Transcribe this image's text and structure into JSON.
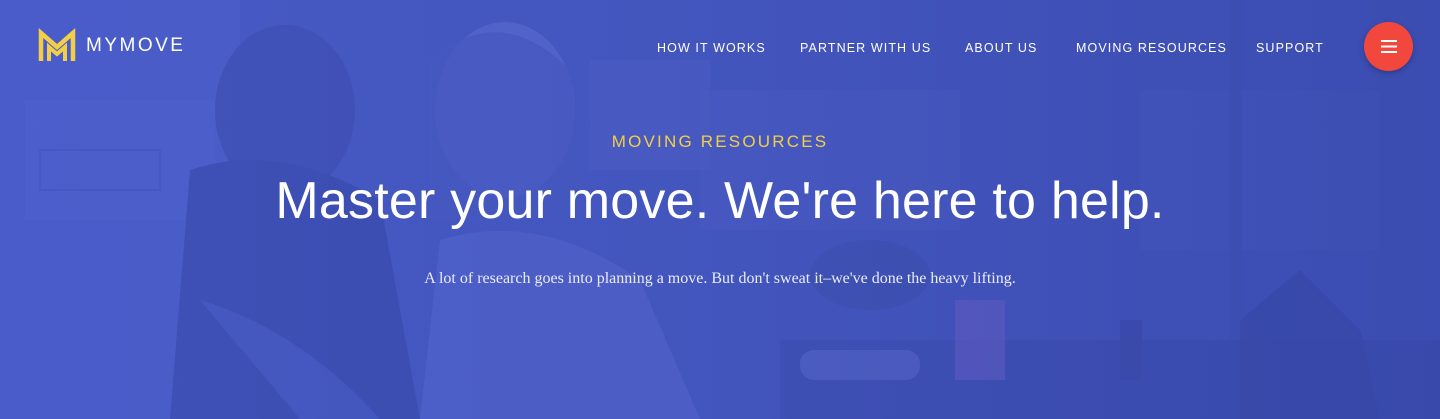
{
  "brand": {
    "name": "MYMOVE",
    "logo_icon": "m-logo-icon",
    "logo_color": "#f2cf47"
  },
  "nav": {
    "items": [
      {
        "label": "HOW IT WORKS"
      },
      {
        "label": "PARTNER WITH US"
      },
      {
        "label": "ABOUT US"
      },
      {
        "label": "MOVING RESOURCES"
      },
      {
        "label": "SUPPORT"
      }
    ],
    "menu_icon": "hamburger-icon",
    "menu_button_color": "#f2473d"
  },
  "hero": {
    "eyebrow": "MOVING RESOURCES",
    "headline": "Master your move. We're here to help.",
    "subtext": "A lot of research goes into planning a move. But don't sweat it–we've done the heavy lifting.",
    "overlay_color": "#4355b8",
    "accent_color": "#f2cf47"
  }
}
